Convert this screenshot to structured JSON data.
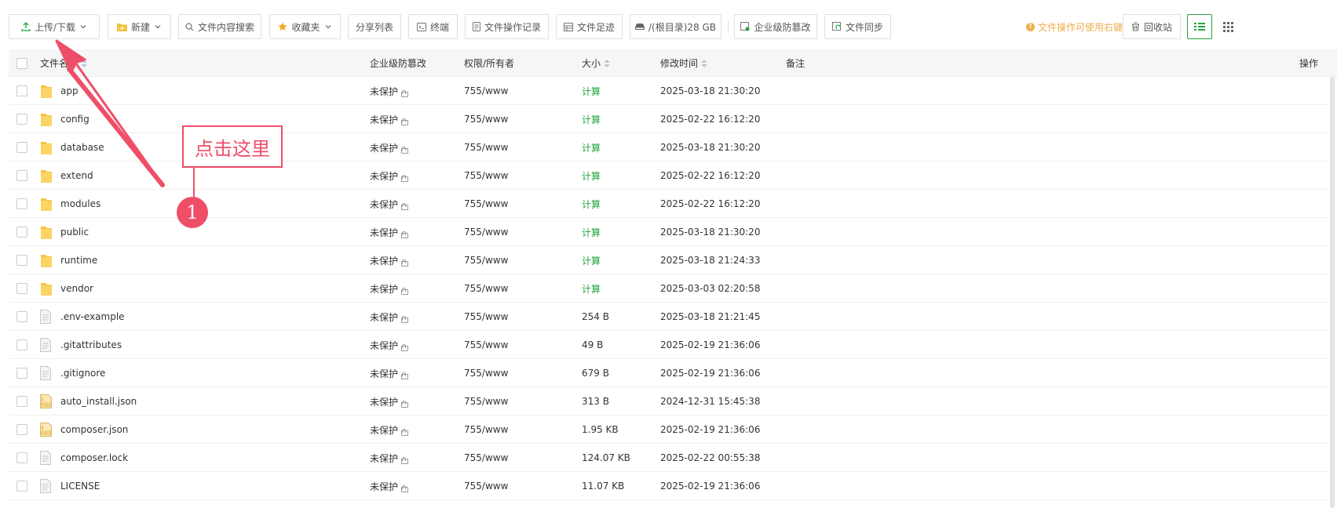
{
  "toolbar": {
    "upload_download": "上传/下载",
    "new": "新建",
    "content_search": "文件内容搜索",
    "favorites": "收藏夹",
    "share_list": "分享列表",
    "terminal": "终端",
    "operation_log": "文件操作记录",
    "footprint": "文件足迹",
    "disk": "/(根目录)28 GB",
    "tamper_proof": "企业级防篡改",
    "file_sync": "文件同步",
    "tip": "文件操作可使用右键",
    "recycle_bin": "回收站"
  },
  "table": {
    "headers": {
      "name": "文件名称",
      "tamper": "企业级防篡改",
      "permission": "权限/所有者",
      "size": "大小",
      "mtime": "修改时间",
      "remark": "备注",
      "action": "操作"
    },
    "rows": [
      {
        "name": "app",
        "type": "folder",
        "tamper": "未保护",
        "permission": "755/www",
        "size": "计算",
        "mtime": "2025-03-18 21:30:20"
      },
      {
        "name": "config",
        "type": "folder",
        "tamper": "未保护",
        "permission": "755/www",
        "size": "计算",
        "mtime": "2025-02-22 16:12:20"
      },
      {
        "name": "database",
        "type": "folder",
        "tamper": "未保护",
        "permission": "755/www",
        "size": "计算",
        "mtime": "2025-03-18 21:30:20"
      },
      {
        "name": "extend",
        "type": "folder",
        "tamper": "未保护",
        "permission": "755/www",
        "size": "计算",
        "mtime": "2025-02-22 16:12:20"
      },
      {
        "name": "modules",
        "type": "folder",
        "tamper": "未保护",
        "permission": "755/www",
        "size": "计算",
        "mtime": "2025-02-22 16:12:20"
      },
      {
        "name": "public",
        "type": "folder",
        "tamper": "未保护",
        "permission": "755/www",
        "size": "计算",
        "mtime": "2025-03-18 21:30:20"
      },
      {
        "name": "runtime",
        "type": "folder",
        "tamper": "未保护",
        "permission": "755/www",
        "size": "计算",
        "mtime": "2025-03-18 21:24:33"
      },
      {
        "name": "vendor",
        "type": "folder",
        "tamper": "未保护",
        "permission": "755/www",
        "size": "计算",
        "mtime": "2025-03-03 02:20:58"
      },
      {
        "name": ".env-example",
        "type": "file",
        "tamper": "未保护",
        "permission": "755/www",
        "size": "254 B",
        "mtime": "2025-03-18 21:21:45"
      },
      {
        "name": ".gitattributes",
        "type": "file",
        "tamper": "未保护",
        "permission": "755/www",
        "size": "49 B",
        "mtime": "2025-02-19 21:36:06"
      },
      {
        "name": ".gitignore",
        "type": "file",
        "tamper": "未保护",
        "permission": "755/www",
        "size": "679 B",
        "mtime": "2025-02-19 21:36:06"
      },
      {
        "name": "auto_install.json",
        "type": "json",
        "tamper": "未保护",
        "permission": "755/www",
        "size": "313 B",
        "mtime": "2024-12-31 15:45:38"
      },
      {
        "name": "composer.json",
        "type": "json",
        "tamper": "未保护",
        "permission": "755/www",
        "size": "1.95 KB",
        "mtime": "2025-02-19 21:36:06"
      },
      {
        "name": "composer.lock",
        "type": "file",
        "tamper": "未保护",
        "permission": "755/www",
        "size": "124.07 KB",
        "mtime": "2025-02-22 00:55:38"
      },
      {
        "name": "LICENSE",
        "type": "file",
        "tamper": "未保护",
        "permission": "755/www",
        "size": "11.07 KB",
        "mtime": "2025-02-19 21:36:06"
      }
    ]
  },
  "annotation": {
    "label": "点击这里",
    "step": "1",
    "color": "#ef4e69"
  },
  "colors": {
    "accent_green": "#20a53a",
    "tip_orange": "#f0ad4e",
    "folder_yellow": "#f5c342"
  }
}
